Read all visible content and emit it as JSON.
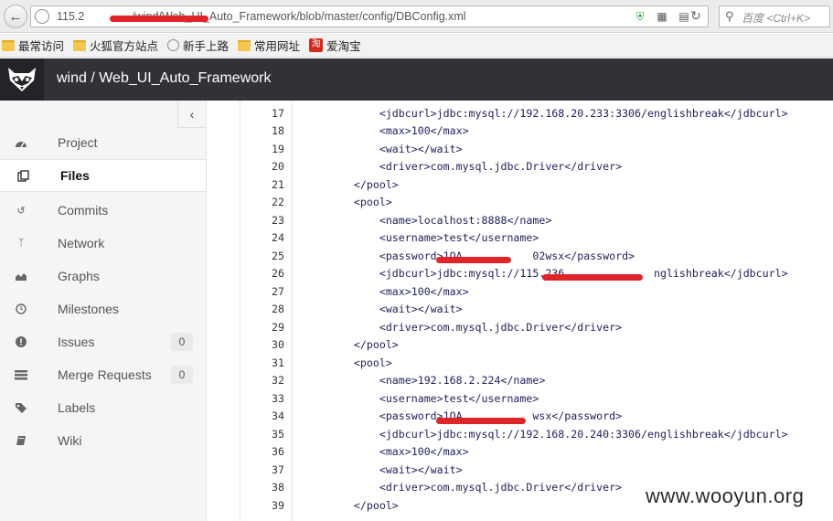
{
  "browser": {
    "url_prefix": "115.2",
    "url_rest": "/wind/Web_UI_Auto_Framework/blob/master/config/DBConfig.xml",
    "search_placeholder": "百度 <Ctrl+K>",
    "bookmarks": [
      {
        "label": "最常访问",
        "icon": "folder-icon"
      },
      {
        "label": "火狐官方站点",
        "icon": "folder-icon"
      },
      {
        "label": "新手上路",
        "icon": "globe-icon"
      },
      {
        "label": "常用网址",
        "icon": "folder-icon"
      },
      {
        "label": "爱淘宝",
        "icon": "taobao-icon"
      }
    ]
  },
  "header": {
    "title": "wind / Web_UI_Auto_Framework"
  },
  "sidebar": {
    "items": [
      {
        "label": "Project",
        "icon": "dashboard-icon",
        "active": false,
        "badge": null
      },
      {
        "label": "Files",
        "icon": "files-icon",
        "active": true,
        "badge": null
      },
      {
        "label": "Commits",
        "icon": "history-icon",
        "active": false,
        "badge": null
      },
      {
        "label": "Network",
        "icon": "code-fork-icon",
        "active": false,
        "badge": null
      },
      {
        "label": "Graphs",
        "icon": "area-chart-icon",
        "active": false,
        "badge": null
      },
      {
        "label": "Milestones",
        "icon": "clock-icon",
        "active": false,
        "badge": null
      },
      {
        "label": "Issues",
        "icon": "exclamation-circle-icon",
        "active": false,
        "badge": "0"
      },
      {
        "label": "Merge Requests",
        "icon": "list-icon",
        "active": false,
        "badge": "0"
      },
      {
        "label": "Labels",
        "icon": "tags-icon",
        "active": false,
        "badge": null
      },
      {
        "label": "Wiki",
        "icon": "book-icon",
        "active": false,
        "badge": null
      }
    ]
  },
  "code": {
    "lines": [
      {
        "n": "17",
        "t": "        <jdbcurl>jdbc:mysql://192.168.20.233:3306/englishbreak</jdbcurl>"
      },
      {
        "n": "18",
        "t": "        <max>100</max>"
      },
      {
        "n": "19",
        "t": "        <wait></wait>"
      },
      {
        "n": "20",
        "t": "        <driver>com.mysql.jdbc.Driver</driver>"
      },
      {
        "n": "21",
        "t": "    </pool>"
      },
      {
        "n": "22",
        "t": "    <pool>"
      },
      {
        "n": "23",
        "t": "        <name>localhost:8888</name>"
      },
      {
        "n": "24",
        "t": "        <username>test</username>"
      },
      {
        "n": "25",
        "t": "        <password>1QA           02wsx</password>"
      },
      {
        "n": "26",
        "t": "        <jdbcurl>jdbc:mysql://115.236              nglishbreak</jdbcurl>"
      },
      {
        "n": "27",
        "t": "        <max>100</max>"
      },
      {
        "n": "28",
        "t": "        <wait></wait>"
      },
      {
        "n": "29",
        "t": "        <driver>com.mysql.jdbc.Driver</driver>"
      },
      {
        "n": "30",
        "t": "    </pool>"
      },
      {
        "n": "31",
        "t": "    <pool>"
      },
      {
        "n": "32",
        "t": "        <name>192.168.2.224</name>"
      },
      {
        "n": "33",
        "t": "        <username>test</username>"
      },
      {
        "n": "34",
        "t": "        <password>1QA           wsx</password>"
      },
      {
        "n": "35",
        "t": "        <jdbcurl>jdbc:mysql://192.168.20.240:3306/englishbreak</jdbcurl>"
      },
      {
        "n": "36",
        "t": "        <max>100</max>"
      },
      {
        "n": "37",
        "t": "        <wait></wait>"
      },
      {
        "n": "38",
        "t": "        <driver>com.mysql.jdbc.Driver</driver>"
      },
      {
        "n": "39",
        "t": "    </pool>"
      }
    ]
  },
  "watermark": "www.wooyun.org",
  "colors": {
    "header_bg": "#313236",
    "sidebar_bg": "#f5f5f5",
    "redaction": "#e0252a"
  }
}
